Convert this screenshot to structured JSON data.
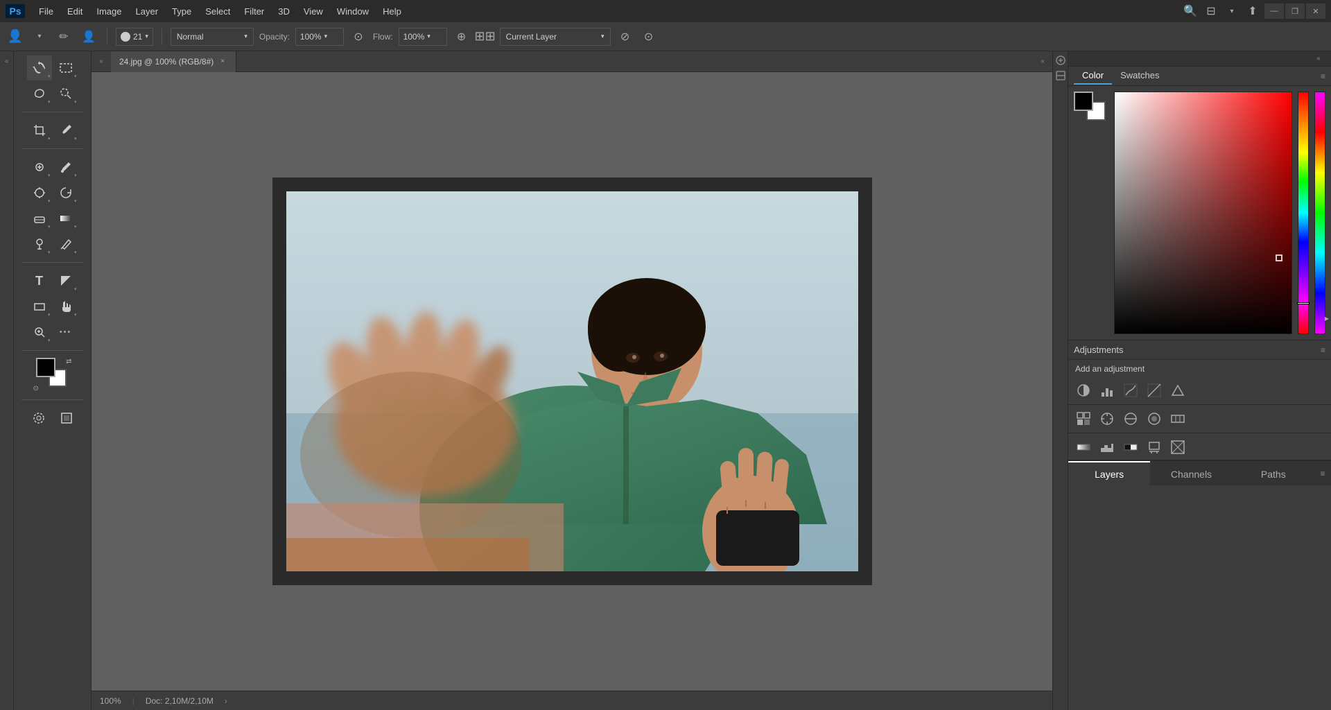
{
  "app": {
    "title": "Adobe Photoshop",
    "logo": "Ps"
  },
  "menu": {
    "items": [
      "File",
      "Edit",
      "Image",
      "Layer",
      "Type",
      "Select",
      "Filter",
      "3D",
      "View",
      "Window",
      "Help"
    ]
  },
  "window_controls": {
    "minimize": "—",
    "maximize": "❐",
    "close": "✕"
  },
  "options_bar": {
    "brush_size": "21",
    "blend_mode": "Normal",
    "blend_mode_arrow": "▾",
    "opacity_label": "Opacity:",
    "opacity_value": "100%",
    "flow_label": "Flow:",
    "flow_value": "100%",
    "sample_label": "Current Layer",
    "sample_arrow": "▾"
  },
  "tab": {
    "filename": "24.jpg @ 100% (RGB/8#)",
    "close": "×"
  },
  "status_bar": {
    "zoom": "100%",
    "doc_info": "Doc: 2,10M/2,10M",
    "arrow": "›"
  },
  "color_panel": {
    "tab1": "Color",
    "tab2": "Swatches",
    "menu_icon": "≡"
  },
  "adjustments_panel": {
    "title": "Adjustments",
    "menu_icon": "≡",
    "add_label": "Add an adjustment",
    "icons": [
      {
        "name": "brightness-contrast-icon",
        "symbol": "☀"
      },
      {
        "name": "levels-icon",
        "symbol": "📊"
      },
      {
        "name": "curves-icon",
        "symbol": "⊞"
      },
      {
        "name": "exposure-icon",
        "symbol": "▣"
      },
      {
        "name": "gradient-map-icon",
        "symbol": "▽"
      },
      {
        "name": "vibrance-icon",
        "symbol": "⬜"
      },
      {
        "name": "hue-sat-icon",
        "symbol": "⬡"
      },
      {
        "name": "color-balance-icon",
        "symbol": "⊙"
      },
      {
        "name": "photo-filter-icon",
        "symbol": "⊕"
      },
      {
        "name": "channel-mixer-icon",
        "symbol": "⊟"
      },
      {
        "name": "gradient-map2-icon",
        "symbol": "⊞"
      },
      {
        "name": "posterize-icon",
        "symbol": "⊟"
      },
      {
        "name": "threshold-icon",
        "symbol": "▧"
      },
      {
        "name": "selective-color-icon",
        "symbol": "✉"
      },
      {
        "name": "invert-icon",
        "symbol": "⬛"
      }
    ]
  },
  "layers_panel": {
    "tabs": [
      {
        "id": "layers",
        "label": "Layers"
      },
      {
        "id": "channels",
        "label": "Channels"
      },
      {
        "id": "paths",
        "label": "Paths"
      }
    ],
    "menu_icon": "≡"
  },
  "tools": {
    "move": "✛",
    "marquee_rect": "⬚",
    "lasso": "⌒",
    "magic_wand": "✳",
    "crop": "⊡",
    "eyedropper": "⌇",
    "healing": "⊕",
    "brush": "🖌",
    "clone": "⊗",
    "history": "⊙",
    "eraser": "◻",
    "gradient": "◫",
    "dodge": "◐",
    "pen": "✒",
    "text": "T",
    "path_sel": "↖",
    "rectangle": "▭",
    "hand": "☞",
    "zoom": "⊕",
    "more": "•••"
  }
}
